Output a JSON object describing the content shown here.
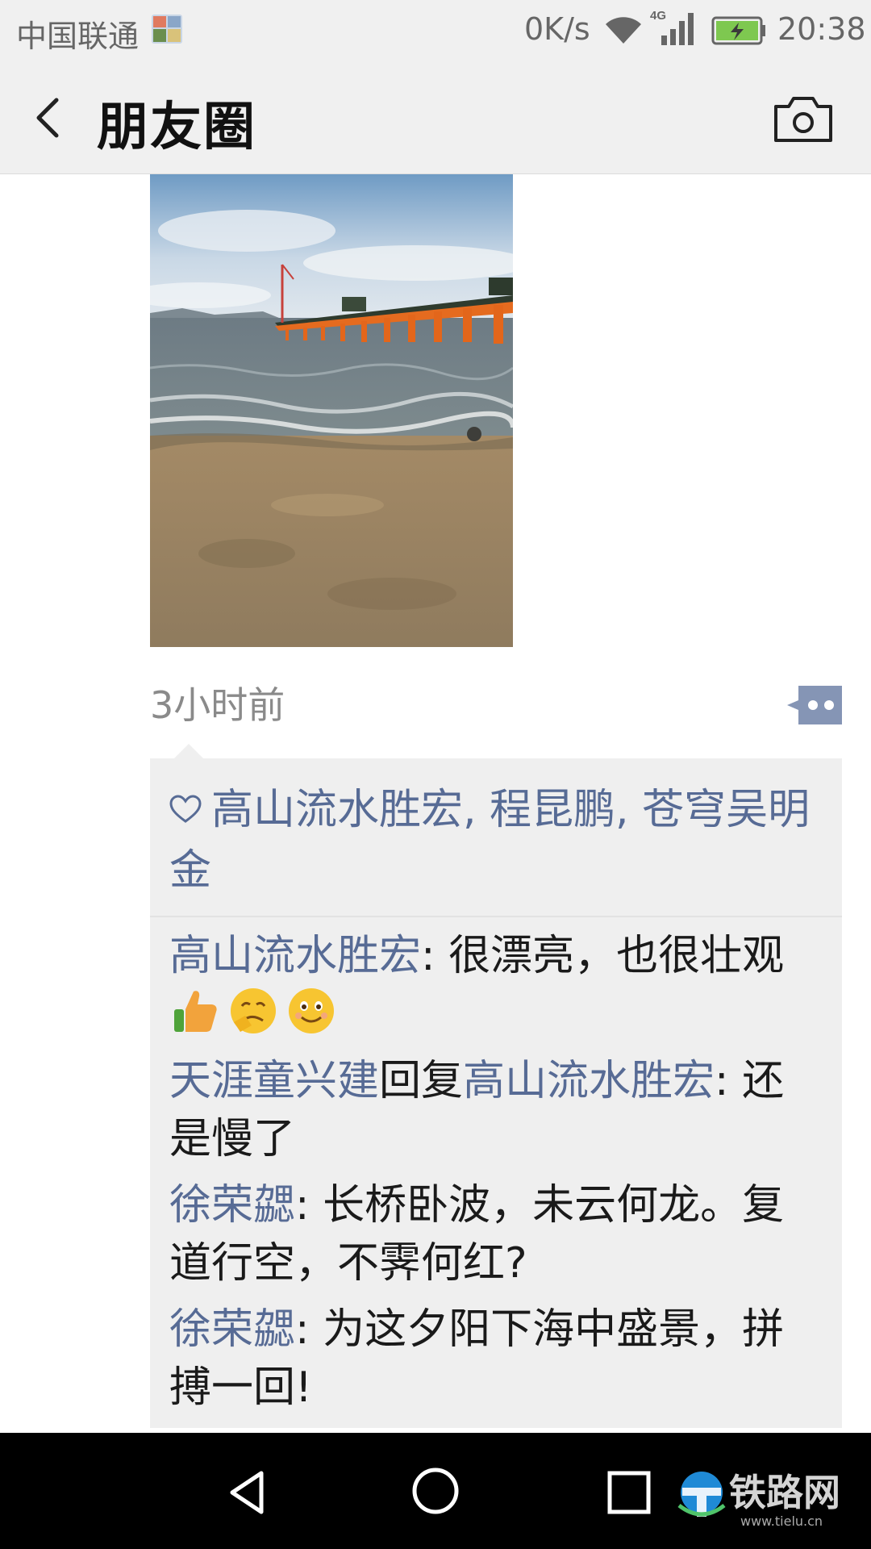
{
  "status_bar": {
    "carrier": "中国联通",
    "net_speed": "0K/s",
    "network_type": "4G",
    "time": "20:38"
  },
  "header": {
    "title": "朋友圈",
    "back_icon": "chevron-left-icon",
    "camera_icon": "camera-icon"
  },
  "post": {
    "time_ago": "3小时前",
    "more_icon": "comment-more-icon",
    "likes": {
      "heart_icon": "heart-outline-icon",
      "names": "高山流水胜宏, 程昆鹏, 苍穹吴明金"
    },
    "comments": [
      {
        "author": "高山流水胜宏",
        "separator": ": ",
        "text": "很漂亮，也很壮观",
        "emojis": [
          "thumbs-up-emoji",
          "thinking-emoji",
          "smile-emoji"
        ]
      },
      {
        "author": "天涯童兴建",
        "reply_word": "回复",
        "reply_to": "高山流水胜宏",
        "separator": ": ",
        "text": "还是慢了"
      },
      {
        "author": "徐荣勰",
        "separator": ": ",
        "text": "长桥卧波，未云何龙。复道行空，不霁何红?"
      },
      {
        "author": "徐荣勰",
        "separator": ": ",
        "text": "为这夕阳下海中盛景，拼搏一回!"
      }
    ]
  },
  "nav_bar": {
    "back_icon": "nav-back-icon",
    "home_icon": "nav-home-icon",
    "recent_icon": "nav-recent-icon"
  },
  "watermark": {
    "text": "铁路网",
    "url": "www.tielu.cn"
  },
  "colors": {
    "link": "#576b95",
    "bar_bg": "#f0f0f0",
    "panel_bg": "#efefef"
  }
}
